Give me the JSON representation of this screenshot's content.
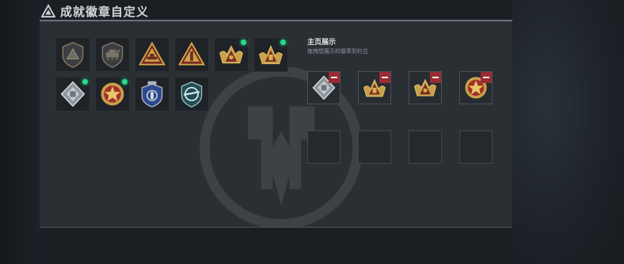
{
  "header": {
    "title": "成就徽章自定义",
    "icon": "warning-triangle-icon"
  },
  "display": {
    "title": "主页展示",
    "hint": "拖拽想展示的徽章到栏位"
  },
  "badges": [
    {
      "icon": "gray-shield-triangle-badge-icon",
      "is_new": false
    },
    {
      "icon": "gray-shield-tank-badge-icon",
      "is_new": false
    },
    {
      "icon": "gold-triangle-vehicle-badge-icon",
      "is_new": false
    },
    {
      "icon": "gold-triangle-number-one-badge-icon",
      "is_new": false
    },
    {
      "icon": "gold-triangle-eagle-badge-icon",
      "is_new": true
    },
    {
      "icon": "gold-triangle-soldier-badge-icon",
      "is_new": true
    },
    {
      "icon": "silver-diamond-badge-icon",
      "is_new": true
    },
    {
      "icon": "red-star-medal-badge-icon",
      "is_new": true
    },
    {
      "icon": "blue-shield-emblem-badge-icon",
      "is_new": false
    },
    {
      "icon": "teal-shield-wings-badge-icon",
      "is_new": false
    }
  ],
  "slots": [
    {
      "icon": "silver-diamond-badge-icon",
      "filled": true
    },
    {
      "icon": "gold-triangle-soldier-badge-icon",
      "filled": true
    },
    {
      "icon": "gold-triangle-eagle-badge-icon",
      "filled": true
    },
    {
      "icon": "red-star-medal-badge-icon",
      "filled": true
    },
    {
      "icon": "",
      "filled": false
    },
    {
      "icon": "",
      "filled": false
    },
    {
      "icon": "",
      "filled": false
    },
    {
      "icon": "",
      "filled": false
    }
  ],
  "colors": {
    "panel": "#2a2f34",
    "new_dot": "#28d98a",
    "remove": "#9a2b33",
    "gold": "#c9a14a"
  }
}
